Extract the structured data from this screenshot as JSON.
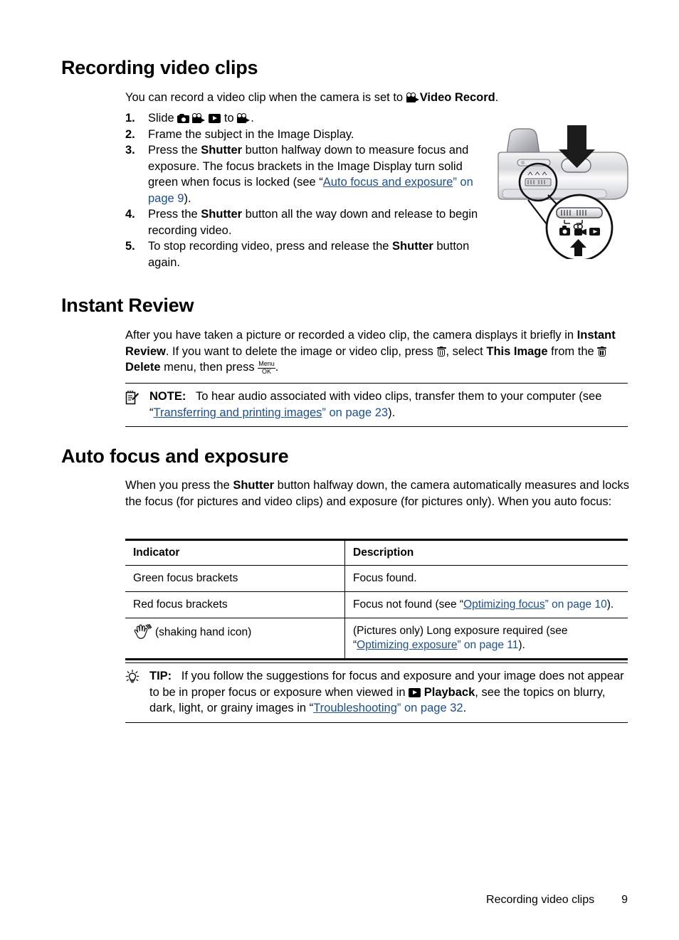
{
  "page": {
    "footer_title": "Recording video clips",
    "footer_page_number": "9",
    "link_color": "#1d4f8c"
  },
  "sections": {
    "recording": {
      "heading": "Recording video clips",
      "intro_before": "You can record a video clip when the camera is set to ",
      "intro_bold": "Video Record",
      "intro_after": ".",
      "steps": [
        {
          "num": "1.",
          "pre": "Slide ",
          "mid": " to ",
          "post": "."
        },
        {
          "num": "2.",
          "text": "Frame the subject in the Image Display."
        },
        {
          "num": "3.",
          "t1": "Press the ",
          "b1": "Shutter",
          "t2": " button halfway down to measure focus and exposure. The focus brackets in the Image Display turn solid green when focus is locked (see “",
          "link": "Auto focus and exposure",
          "t3": "” on page 9",
          "t4": ")."
        },
        {
          "num": "4.",
          "t1": "Press the ",
          "b1": "Shutter",
          "t2": " button all the way down and release to begin recording video."
        },
        {
          "num": "5.",
          "t1": "To stop recording video, press and release the ",
          "b1": "Shutter",
          "t2": " button again."
        }
      ]
    },
    "instant_review": {
      "heading": "Instant Review",
      "p1_t1": "After you have taken a picture or recorded a video clip, the camera displays it briefly in ",
      "p1_b1": "Instant Review",
      "p1_t2": ". If you want to delete the image or video clip, press ",
      "p1_t3": ", select ",
      "p1_b2": "This Image",
      "p1_t4": " from the ",
      "p1_b3": "Delete",
      "p1_t5": " menu, then press ",
      "p1_t6": "."
    },
    "note": {
      "icon": "notepad-pencil-icon",
      "label": "NOTE:",
      "t1": "To hear audio associated with video clips, transfer them to your computer (see “",
      "link": "Transferring and printing images",
      "t2": "” on page 23",
      "t3": ")."
    },
    "auto_focus": {
      "heading": "Auto focus and exposure",
      "p1_t1": "When you press the ",
      "p1_b1": "Shutter",
      "p1_t2": " button halfway down, the camera automatically measures and locks the focus (for pictures and video clips) and exposure (for pictures only). When you auto focus:"
    },
    "tip": {
      "icon": "lightbulb-icon",
      "label": "TIP:",
      "t1": "If you follow the suggestions for focus and exposure and your image does not appear to be in proper focus or exposure when viewed in ",
      "b1": "Playback",
      "t2": ", see the topics on blurry, dark, light, or grainy images in “",
      "link": "Troubleshooting",
      "t3": "” on page 32",
      "t4": "."
    }
  },
  "table": {
    "headers": [
      "Indicator",
      "Description"
    ],
    "rows": [
      {
        "indicator": "Green focus brackets",
        "desc_t1": "Focus found.",
        "link": "",
        "desc_t2": ""
      },
      {
        "indicator": "Red focus brackets",
        "desc_t1": "Focus not found (see “",
        "link": "Optimizing focus",
        "desc_t2": "” on page 10",
        "desc_t3": ")."
      },
      {
        "indicator": "(shaking hand icon)",
        "indicator_icon": "shaking-hand-icon",
        "desc_t1": "(Pictures only) Long exposure required (see “",
        "link": "Optimizing exposure",
        "desc_t2": "” on page 11",
        "desc_t3": ")."
      }
    ]
  },
  "icons": {
    "menu_ok_top": "Menu",
    "menu_ok_bottom": "OK",
    "camera_mode_icon": "still-camera-icon",
    "video_mode_icon": "video-camera-icon",
    "playback_mode_icon": "playback-icon",
    "delete_icon": "trash-icon"
  },
  "illustration": {
    "name": "camera-top-view-with-mode-switch-callout",
    "alt": "Top view of camera showing shutter button with downward arrow and magnified callout of the mode slide switch with still, video and playback icons, arrow pointing to video"
  }
}
